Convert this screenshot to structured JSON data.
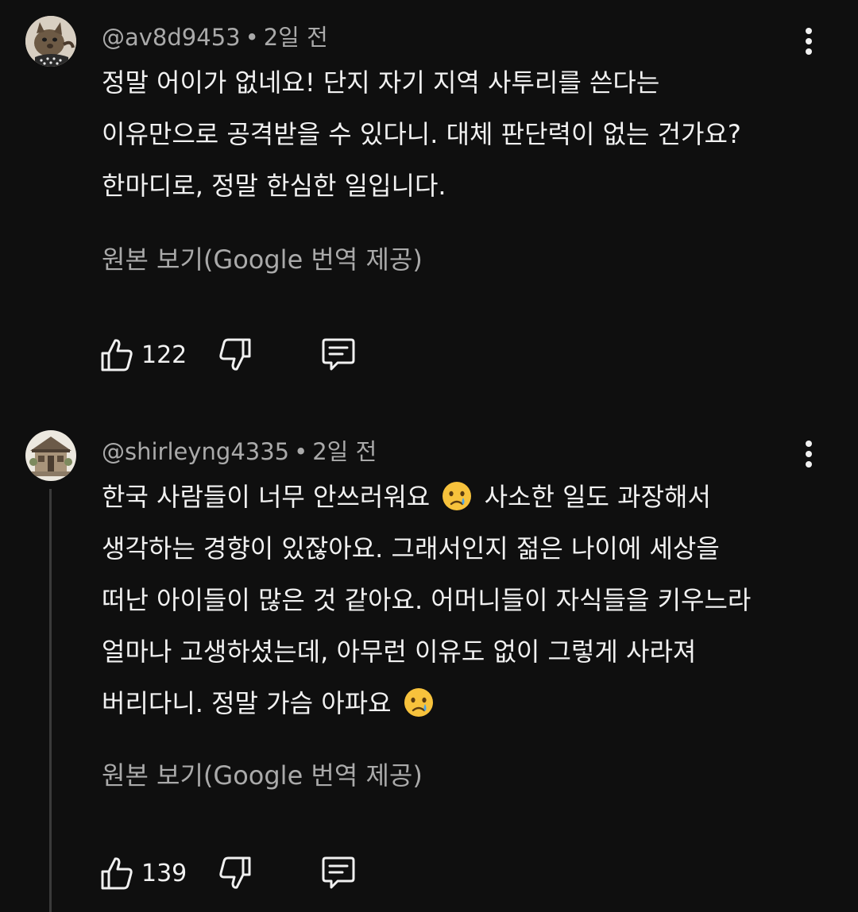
{
  "comments": [
    {
      "handle": "@av8d9453",
      "time": "2일 전",
      "lines": [
        "정말 어이가 없네요! 단지 자기 지역 사투리를 쓴다는",
        "이유만으로 공격받을 수 있다니. 대체 판단력이 없는 건가요?",
        "한마디로, 정말 한심한 일입니다."
      ],
      "translate_label": "원본 보기(Google 번역 제공)",
      "likes": "122",
      "avatar_icon": "cat-avatar"
    },
    {
      "handle": "@shirleyng4335",
      "time": "2일 전",
      "lines": [
        {
          "before": "한국 사람들이 너무 안쓰러워요 ",
          "after": " 사소한 일도 과장해서"
        },
        "생각하는 경향이 있잖아요. 그래서인지 젊은 나이에 세상을",
        "떠난 아이들이 많은 것 같아요. 어머니들이 자식들을 키우느라",
        "얼마나 고생하셨는데, 아무런 이유도 없이 그렇게 사라져",
        {
          "before": "버리다니. 정말 가슴 아파요 ",
          "after": ""
        }
      ],
      "translate_label": "원본 보기(Google 번역 제공)",
      "likes": "139",
      "avatar_icon": "house-avatar"
    }
  ],
  "icons": {
    "separator": "•",
    "emoji": "crying-face-emoji"
  },
  "colors": {
    "background": "#0f0f0f",
    "text_primary": "#f1f1f1",
    "text_secondary": "#aaaaaa",
    "thread_line": "#3a3a3a"
  }
}
